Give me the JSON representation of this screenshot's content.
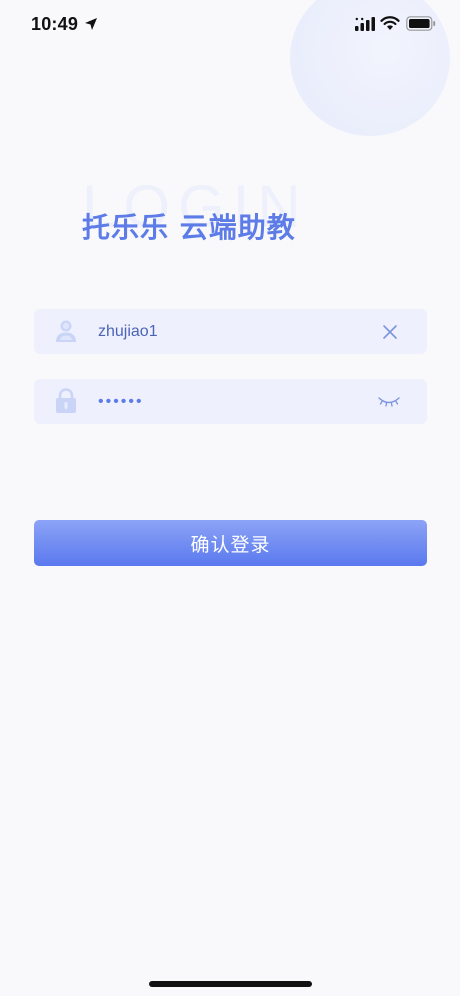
{
  "status_bar": {
    "time": "10:49",
    "icons": [
      "location-arrow-icon",
      "signal-icon",
      "wifi-icon",
      "battery-icon"
    ]
  },
  "header": {
    "watermark": "LOGIN",
    "title": "托乐乐 云端助教"
  },
  "form": {
    "username": {
      "value": "zhujiao1",
      "icon": "user-icon",
      "action_icon": "clear-icon"
    },
    "password": {
      "value": "••••••",
      "icon": "lock-icon",
      "action_icon": "eye-closed-icon"
    },
    "submit_label": "确认登录"
  },
  "colors": {
    "accent": "#5d7ce8",
    "field_bg": "#eef1fd",
    "page_bg": "#f9f9fb",
    "button_top": "#8ca3f6",
    "button_bottom": "#5a79ee"
  }
}
